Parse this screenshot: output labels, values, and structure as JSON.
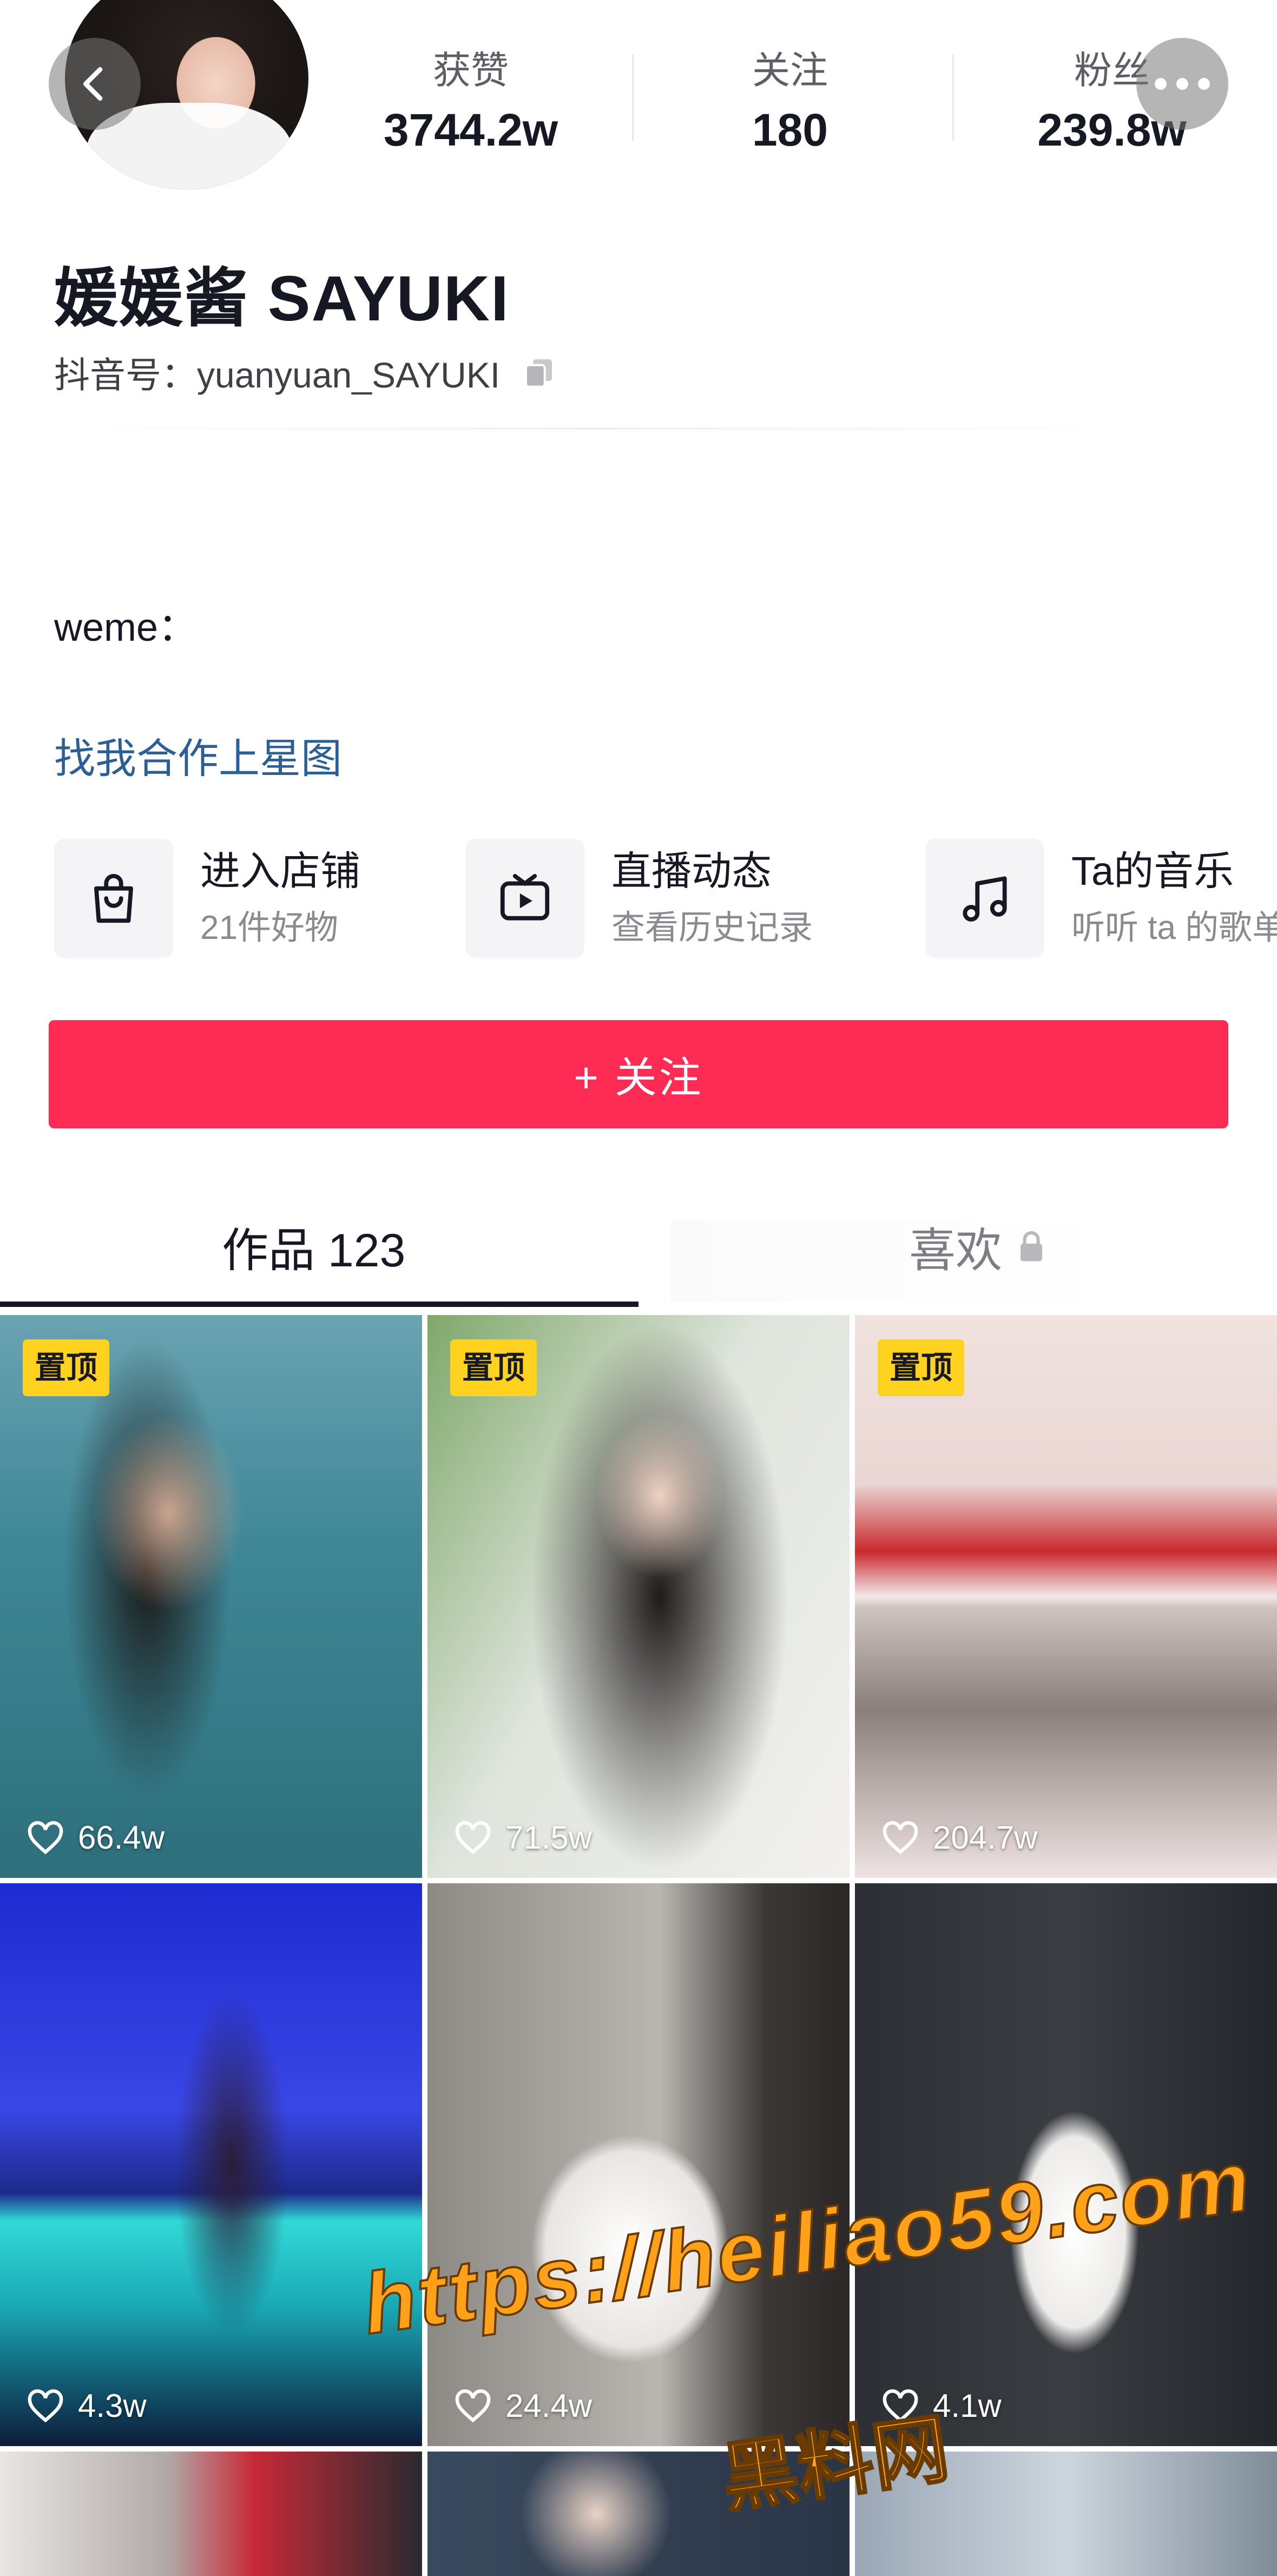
{
  "header": {
    "stats": [
      {
        "label": "获赞",
        "value": "3744.2w"
      },
      {
        "label": "关注",
        "value": "180"
      },
      {
        "label": "粉丝",
        "value": "239.8w"
      }
    ]
  },
  "profile": {
    "name": "媛媛酱 SAYUKI",
    "douyin_id": "抖音号：yuanyuan_SAYUKI",
    "bio": "weme：",
    "xingtu_link": "找我合作上星图"
  },
  "features": [
    {
      "icon": "shopping-bag-icon",
      "title": "进入店铺",
      "subtitle": "21件好物"
    },
    {
      "icon": "tv-icon",
      "title": "直播动态",
      "subtitle": "查看历史记录"
    },
    {
      "icon": "music-note-icon",
      "title": "Ta的音乐",
      "subtitle": "听听 ta 的歌单"
    }
  ],
  "follow_button": "+ 关注",
  "tabs": {
    "works": "作品 123",
    "likes": "喜欢"
  },
  "videos": [
    {
      "pinned": true,
      "pin_label": "置顶",
      "likes": "66.4w"
    },
    {
      "pinned": true,
      "pin_label": "置顶",
      "likes": "71.5w"
    },
    {
      "pinned": true,
      "pin_label": "置顶",
      "likes": "204.7w"
    },
    {
      "pinned": false,
      "likes": "4.3w"
    },
    {
      "pinned": false,
      "likes": "24.4w"
    },
    {
      "pinned": false,
      "likes": "4.1w"
    }
  ],
  "watermark": {
    "url": "https://heiliao59.com",
    "site": "黑料网"
  },
  "colors": {
    "accent": "#fe2c55",
    "link": "#2b5f96",
    "pin_badge": "#ffd21f",
    "watermark": "#ffa21a"
  }
}
